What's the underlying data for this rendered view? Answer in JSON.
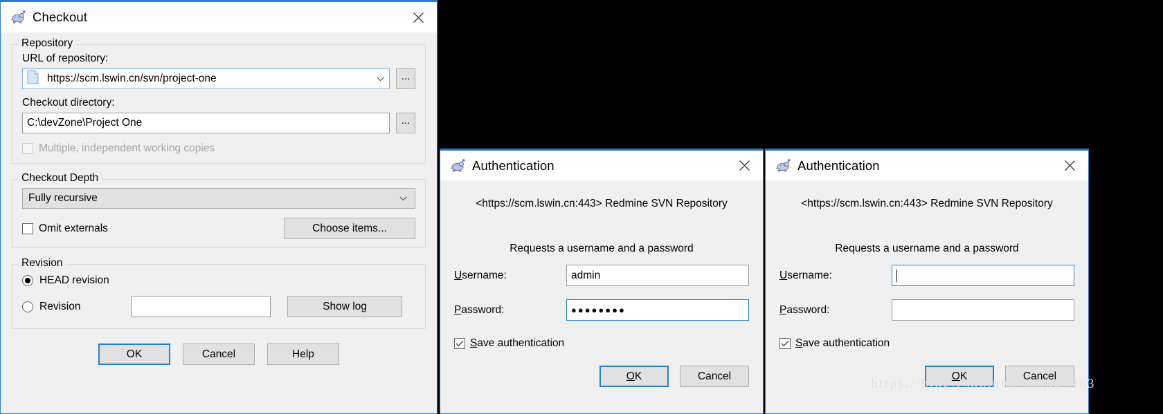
{
  "checkout": {
    "title": "Checkout",
    "icon": "tortoise-svn-icon",
    "close_icon": "close-icon",
    "repository": {
      "legend": "Repository",
      "url_label": "URL of repository:",
      "url_value": "https://scm.lswin.cn/svn/project-one",
      "url_icon": "document-icon",
      "url_dropdown_icon": "chevron-down-icon",
      "browse_label": "...",
      "dir_label": "Checkout directory:",
      "dir_value": "C:\\devZone\\Project One",
      "dir_browse_label": "...",
      "multiple_label": "Multiple, independent working copies",
      "multiple_checked": false,
      "multiple_disabled": true
    },
    "depth": {
      "legend": "Checkout Depth",
      "selected": "Fully recursive",
      "dropdown_icon": "chevron-down-icon",
      "omit_externals_label": "Omit externals",
      "omit_externals_checked": false,
      "choose_items_label": "Choose items..."
    },
    "revision": {
      "legend": "Revision",
      "head_label": "HEAD revision",
      "head_selected": true,
      "revision_label": "Revision",
      "revision_selected": false,
      "revision_value": "",
      "show_log_label": "Show log"
    },
    "buttons": {
      "ok": "OK",
      "cancel": "Cancel",
      "help": "Help"
    }
  },
  "auth_dialogs": [
    {
      "title": "Authentication",
      "icon": "tortoise-svn-icon",
      "close_icon": "close-icon",
      "realm": "<https://scm.lswin.cn:443> Redmine SVN Repository",
      "prompt": "Requests a username and a password",
      "username_label_prefix": "U",
      "username_label_rest": "sername:",
      "username_value": "admin",
      "username_focused": false,
      "password_label_prefix": "P",
      "password_label_rest": "assword:",
      "password_value": "●●●●●●●●",
      "password_focused": true,
      "save_label_prefix": "S",
      "save_label_rest": "ave authentication",
      "save_checked": true,
      "ok_prefix": "O",
      "ok_rest": "K",
      "cancel_label": "Cancel"
    },
    {
      "title": "Authentication",
      "icon": "tortoise-svn-icon",
      "close_icon": "close-icon",
      "realm": "<https://scm.lswin.cn:443> Redmine SVN Repository",
      "prompt": "Requests a username and a password",
      "username_label_prefix": "U",
      "username_label_rest": "sername:",
      "username_value": "",
      "username_focused": true,
      "password_label_prefix": "P",
      "password_label_rest": "assword:",
      "password_value": "",
      "password_focused": false,
      "save_label_prefix": "S",
      "save_label_rest": "ave authentication",
      "save_checked": true,
      "ok_prefix": "O",
      "ok_rest": "K",
      "cancel_label": "Cancel"
    }
  ],
  "watermark": {
    "text": "https://blog.csdn.net/laotou1963"
  },
  "colors": {
    "accent": "#2a7fc9",
    "dialog_bg": "#f0f0f0",
    "titlebar_bg": "#ffffff",
    "button_bg": "#e1e1e1",
    "backdrop": "#000000"
  }
}
